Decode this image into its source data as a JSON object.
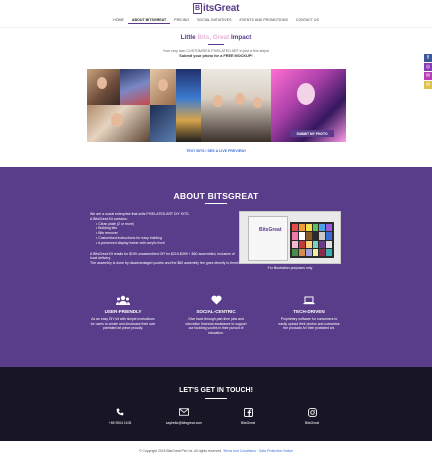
{
  "header": {
    "logo_mark": "B",
    "logo_text": "itsGreat",
    "nav": [
      {
        "label": "Home",
        "active": false
      },
      {
        "label": "About BitsGreat",
        "active": true
      },
      {
        "label": "Pricing",
        "active": false
      },
      {
        "label": "Social Initiatives",
        "active": false
      },
      {
        "label": "Events and Promotions",
        "active": false
      },
      {
        "label": "Contact Us",
        "active": false
      }
    ]
  },
  "hero": {
    "title_pre": "Little ",
    "title_accent": "Bits, Great",
    "title_post": " Impact",
    "sub1": "Your very own CUSTOMISED PIXELATED ART in just a few steps!",
    "sub2": "Submit your photo for a FREE MOCKUP!",
    "submit_button": "Submit my photo",
    "preview_link": "Text BITS / See a live preview!"
  },
  "about": {
    "title": "ABOUT BITSGREAT",
    "intro": "We are a social enterprise that sells PIXELATED ART DIY KITS.",
    "kit_intro": "A BitsGreat Kit contains:",
    "kit_items": [
      "Clean plate (2 or more)",
      "Building kits",
      "Bits remover",
      "Customised instructions for easy building",
      "A preserved display frame with acrylic front"
    ],
    "pricing_text": "A BitsGreat Kit retails for $199 unassembled OR for $219-$399 + $60 assembled, inclusive of local delivery.",
    "assembly_text": "The assembly is done by disadvantaged youths and the $60 assembly fee goes directly to them!",
    "image_caption": "For illustration purposes only",
    "kit_logo": "BitsGreat",
    "features": [
      {
        "icon": "users-icon",
        "title": "User-Friendly",
        "desc": "As an easy DIY kit with simple instructions for users to create and showcase their own pixelated art piece proudly."
      },
      {
        "icon": "heart-icon",
        "title": "Social-Centric",
        "desc": "Give back through part-time jobs and education financial assistance to support our budding youths in their pursuit of education."
      },
      {
        "icon": "laptop-icon",
        "title": "Tech-Driven",
        "desc": "Proprietary software for consumers to easily upload their photos and customise the products for their pixelated art."
      }
    ]
  },
  "contact": {
    "title": "LET'S GET IN TOUCH!",
    "items": [
      {
        "icon": "phone-icon",
        "label": "+65 9004 1108"
      },
      {
        "icon": "email-icon",
        "label": "sayhello@bitsgreat.com"
      },
      {
        "icon": "facebook-icon",
        "label": "BitsGreat"
      },
      {
        "icon": "instagram-icon",
        "label": "BitsGreat"
      }
    ]
  },
  "footer": {
    "text": "© Copyright 2018 BitsGreat Pte Ltd. All rights reserved.",
    "terms": "Terms And Conditions",
    "privacy": "Data Protection Notice"
  },
  "colors": {
    "brand": "#5b3a8c",
    "about_bg": "#5a3d8a",
    "contact_bg": "#181526",
    "link": "#3a6fd6"
  }
}
